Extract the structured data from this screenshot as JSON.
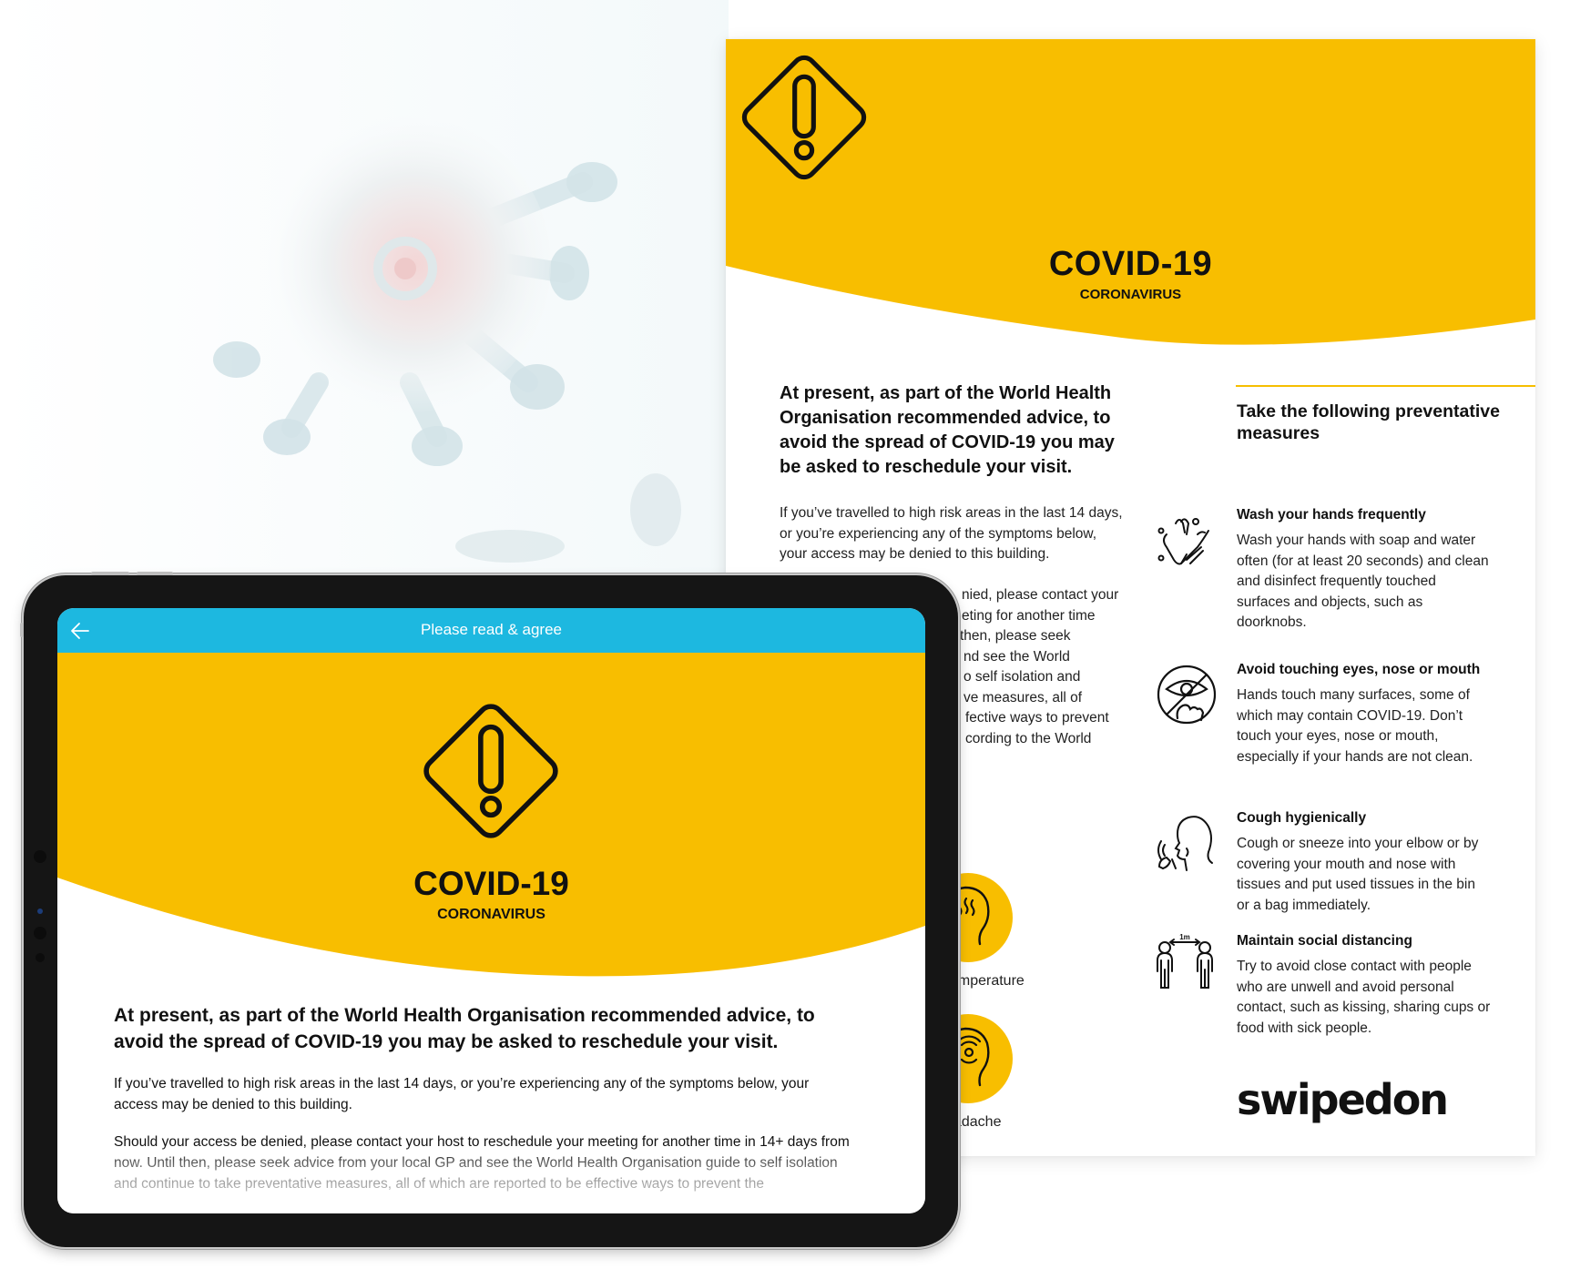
{
  "colors": {
    "brand_yellow": "#f8be00",
    "topbar_blue": "#1db8e0",
    "text_dark": "#111111",
    "device_bezel": "#151515"
  },
  "poster": {
    "hero": {
      "icon": "warning-diamond-icon",
      "title": "COVID-19",
      "subtitle": "CORONAVIRUS"
    },
    "lead": "At present, as part of the World Health Organisation recommended advice, to avoid the spread of COVID-19 you may be asked to reschedule your visit.",
    "paragraph_1": "If you’ve travelled to high risk areas in the last 14 days, or you’re experiencing any of the symptoms below, your access may be denied to this building.",
    "paragraph_2_visible_lines": [
      "nied, please contact your",
      "eting for another time",
      " then, please seek",
      "nd see the World",
      "o self isolation and",
      "ve measures, all of",
      "fective ways to prevent",
      "cording to the World"
    ],
    "symptoms": [
      {
        "icon": "high-temperature-head-icon",
        "label": "High temperature"
      },
      {
        "icon": "headache-head-icon",
        "label": "Headache"
      }
    ],
    "measures_title": "Take the following preventative measures",
    "measures": [
      {
        "icon": "hand-washing-icon",
        "title": "Wash your hands frequently",
        "body": "Wash your hands with soap and water often (for at least 20 seconds) and clean and disinfect frequently touched surfaces and objects, such as doorknobs."
      },
      {
        "icon": "no-touching-face-icon",
        "title": "Avoid touching eyes, nose or mouth",
        "body": "Hands touch many surfaces, some of which may contain COVID-19. Don’t touch your eyes, nose or mouth, especially if your hands are not clean."
      },
      {
        "icon": "cough-icon",
        "title": "Cough hygienically",
        "body": "Cough or sneeze into your elbow or by covering your mouth and nose with tissues and put used tissues in the bin or a bag immediately."
      },
      {
        "icon": "social-distancing-icon",
        "title": "Maintain social distancing",
        "distance_label": "1m",
        "body": "Try to avoid close contact with people who are unwell and avoid personal contact, such as kissing, sharing cups or food with sick people."
      }
    ],
    "logo": "swipedon"
  },
  "tablet": {
    "topbar": {
      "back_icon": "back-arrow-icon",
      "title": "Please read & agree"
    },
    "hero": {
      "icon": "warning-diamond-icon",
      "title": "COVID-19",
      "subtitle": "CORONAVIRUS"
    },
    "lead": "At present, as part of the World Health Organisation recommended advice, to avoid the spread of COVID-19 you may be asked to reschedule your visit.",
    "paragraph_1": "If you’ve travelled to high risk areas in the last 14 days, or you’re experiencing any of the symptoms below, your access may be denied to this building.",
    "paragraph_2": "Should your access be denied, please contact your host to reschedule your meeting for another time in 14+ days from now. Until then, please seek advice from your local GP and see the World Health Organisation guide to self isolation and continue to take preventative measures, all of which are reported to be effective ways to prevent the"
  }
}
